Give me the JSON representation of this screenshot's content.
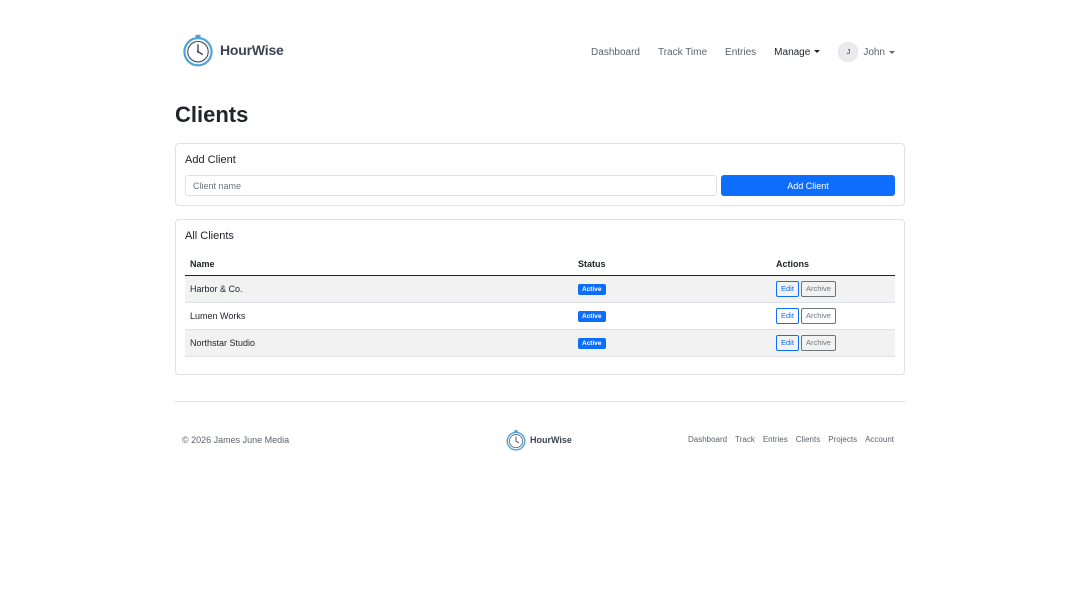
{
  "brand": {
    "name": "HourWise",
    "icon": "stopwatch-logo-icon"
  },
  "nav": {
    "links": [
      "Dashboard",
      "Track Time",
      "Entries"
    ],
    "manage": "Manage",
    "user": {
      "initial": "J",
      "name": "John"
    }
  },
  "page": {
    "title": "Clients"
  },
  "add_client": {
    "title": "Add Client",
    "placeholder": "Client name",
    "button": "Add Client"
  },
  "all_clients": {
    "title": "All Clients",
    "columns": [
      "Name",
      "Status",
      "Actions"
    ],
    "rows": [
      {
        "name": "Harbor & Co.",
        "status": "Active",
        "edit": "Edit",
        "archive": "Archive"
      },
      {
        "name": "Lumen Works",
        "status": "Active",
        "edit": "Edit",
        "archive": "Archive"
      },
      {
        "name": "Northstar Studio",
        "status": "Active",
        "edit": "Edit",
        "archive": "Archive"
      }
    ]
  },
  "footer": {
    "copyright": "© 2026 James June Media",
    "brand": "HourWise",
    "links": [
      "Dashboard",
      "Track",
      "Entries",
      "Clients",
      "Projects",
      "Account"
    ]
  },
  "colors": {
    "primary": "#0d6efd",
    "logo_ring": "#4da3d9",
    "text": "#212529",
    "muted": "#6c757d"
  }
}
